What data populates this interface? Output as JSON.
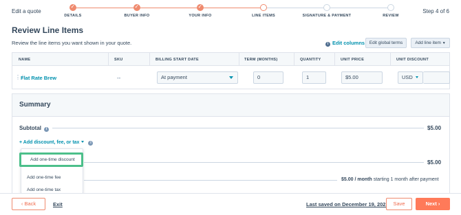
{
  "header": {
    "edit_title": "Edit a quote",
    "step_indicator": "Step 4 of 6",
    "steps": [
      {
        "label": "DETAILS",
        "state": "done"
      },
      {
        "label": "BUYER INFO",
        "state": "done"
      },
      {
        "label": "YOUR INFO",
        "state": "done"
      },
      {
        "label": "LINE ITEMS",
        "state": "current"
      },
      {
        "label": "SIGNATURE & PAYMENT",
        "state": "todo"
      },
      {
        "label": "REVIEW",
        "state": "todo"
      }
    ]
  },
  "main": {
    "title": "Review Line Items",
    "subtitle": "Review the line items you want shown in your quote.",
    "edit_columns_label": "Edit columns",
    "edit_global_terms_label": "Edit global terms",
    "add_line_item_label": "Add line item"
  },
  "table": {
    "columns": [
      "NAME",
      "SKU",
      "BILLING START DATE",
      "TERM (MONTHS)",
      "QUANTITY",
      "UNIT PRICE",
      "UNIT DISCOUNT"
    ],
    "row": {
      "name": "Flat Rate Brew",
      "sku": "--",
      "billing_start": "At payment",
      "term": "0",
      "quantity": "1",
      "unit_price": "$5.00",
      "currency": "USD"
    }
  },
  "summary": {
    "title": "Summary",
    "subtotal_label": "Subtotal",
    "subtotal_value": "$5.00",
    "add_discount_label": "+ Add discount, fee, or tax",
    "total_value": "$5.00",
    "recurring_amount": "$5.00 / month",
    "recurring_note": "starting 1 month after payment"
  },
  "dropdown": {
    "items": [
      "Add one-time discount",
      "Add one-time fee",
      "Add one-time tax"
    ]
  },
  "footer": {
    "back_label": "Back",
    "exit_label": "Exit",
    "last_saved": "Last saved on December 19, 2023",
    "save_label": "Save",
    "next_label": "Next"
  },
  "colors": {
    "accent": "#ff7a59",
    "link": "#0091ae",
    "highlight": "#4cbf8a",
    "text": "#33475b"
  }
}
